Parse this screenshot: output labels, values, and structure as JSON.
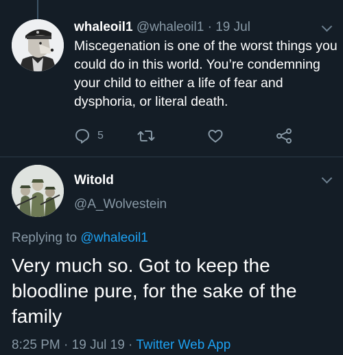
{
  "tweet1": {
    "display_name": "whaleoil1",
    "handle": "@whaleoil1",
    "separator": " · ",
    "date": "19 Jul",
    "text": "Miscegenation is one of the worst things you could do in this world. You’re condemning your child to either a life of fear and dysphoria, or literal death.",
    "reply_count": "5",
    "avatar_icon": "wolf-soldier-avatar",
    "actions": [
      "reply-icon",
      "retweet-icon",
      "like-icon",
      "share-icon"
    ]
  },
  "tweet2": {
    "display_name": "Witold",
    "handle": "@A_Wolvestein",
    "replying_prefix": "Replying to ",
    "replying_to": "@whaleoil1",
    "text": "Very much so. Got to keep the bloodline pure, for the sake of the family",
    "time": "8:25 PM",
    "separator1": " · ",
    "date": "19 Jul 19",
    "separator2": " · ",
    "source": "Twitter Web App",
    "avatar_icon": "group-soldiers-avatar"
  },
  "colors": {
    "background": "#141d26",
    "text": "#ffffff",
    "muted": "#8899a6",
    "link": "#1da1f2"
  }
}
